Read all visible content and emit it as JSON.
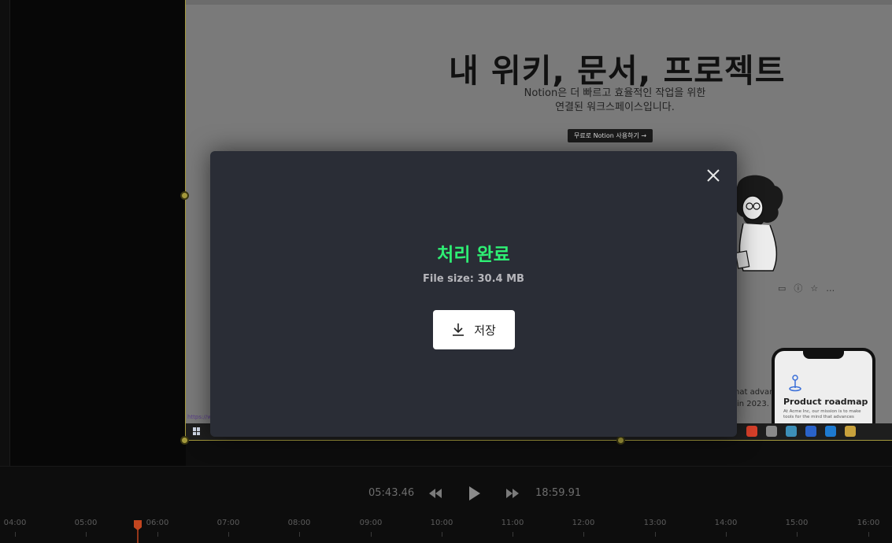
{
  "preview": {
    "hero_title": "내 위키, 문서, 프로젝트",
    "hero_sub_line1": "Notion은 더 빠르고 효율적인 작업을 위한",
    "hero_sub_line2": "연결된 워크스페이스입니다.",
    "cta_label": "무료로 Notion 사용하기 →",
    "text_fragment_1": "hat advan",
    "text_fragment_2": "in 2023.",
    "url_fragment": "https://w",
    "phone_title": "Product roadmap",
    "phone_body": "At Acme Inc, our mission is to make tools for the mind that advances"
  },
  "modal": {
    "title": "처리 완료",
    "file_size": "File size: 30.4 MB",
    "save_label": "저장",
    "title_color": "#2eef74"
  },
  "player": {
    "current_time": "05:43.46",
    "total_time": "18:59.91"
  },
  "timeline": {
    "ticks": [
      "04:00",
      "05:00",
      "06:00",
      "07:00",
      "08:00",
      "09:00",
      "10:00",
      "11:00",
      "12:00",
      "13:00",
      "14:00",
      "15:00",
      "16:00"
    ],
    "playhead_color": "#c2451f"
  },
  "accent_colors": {
    "selection": "#a59a3c"
  }
}
